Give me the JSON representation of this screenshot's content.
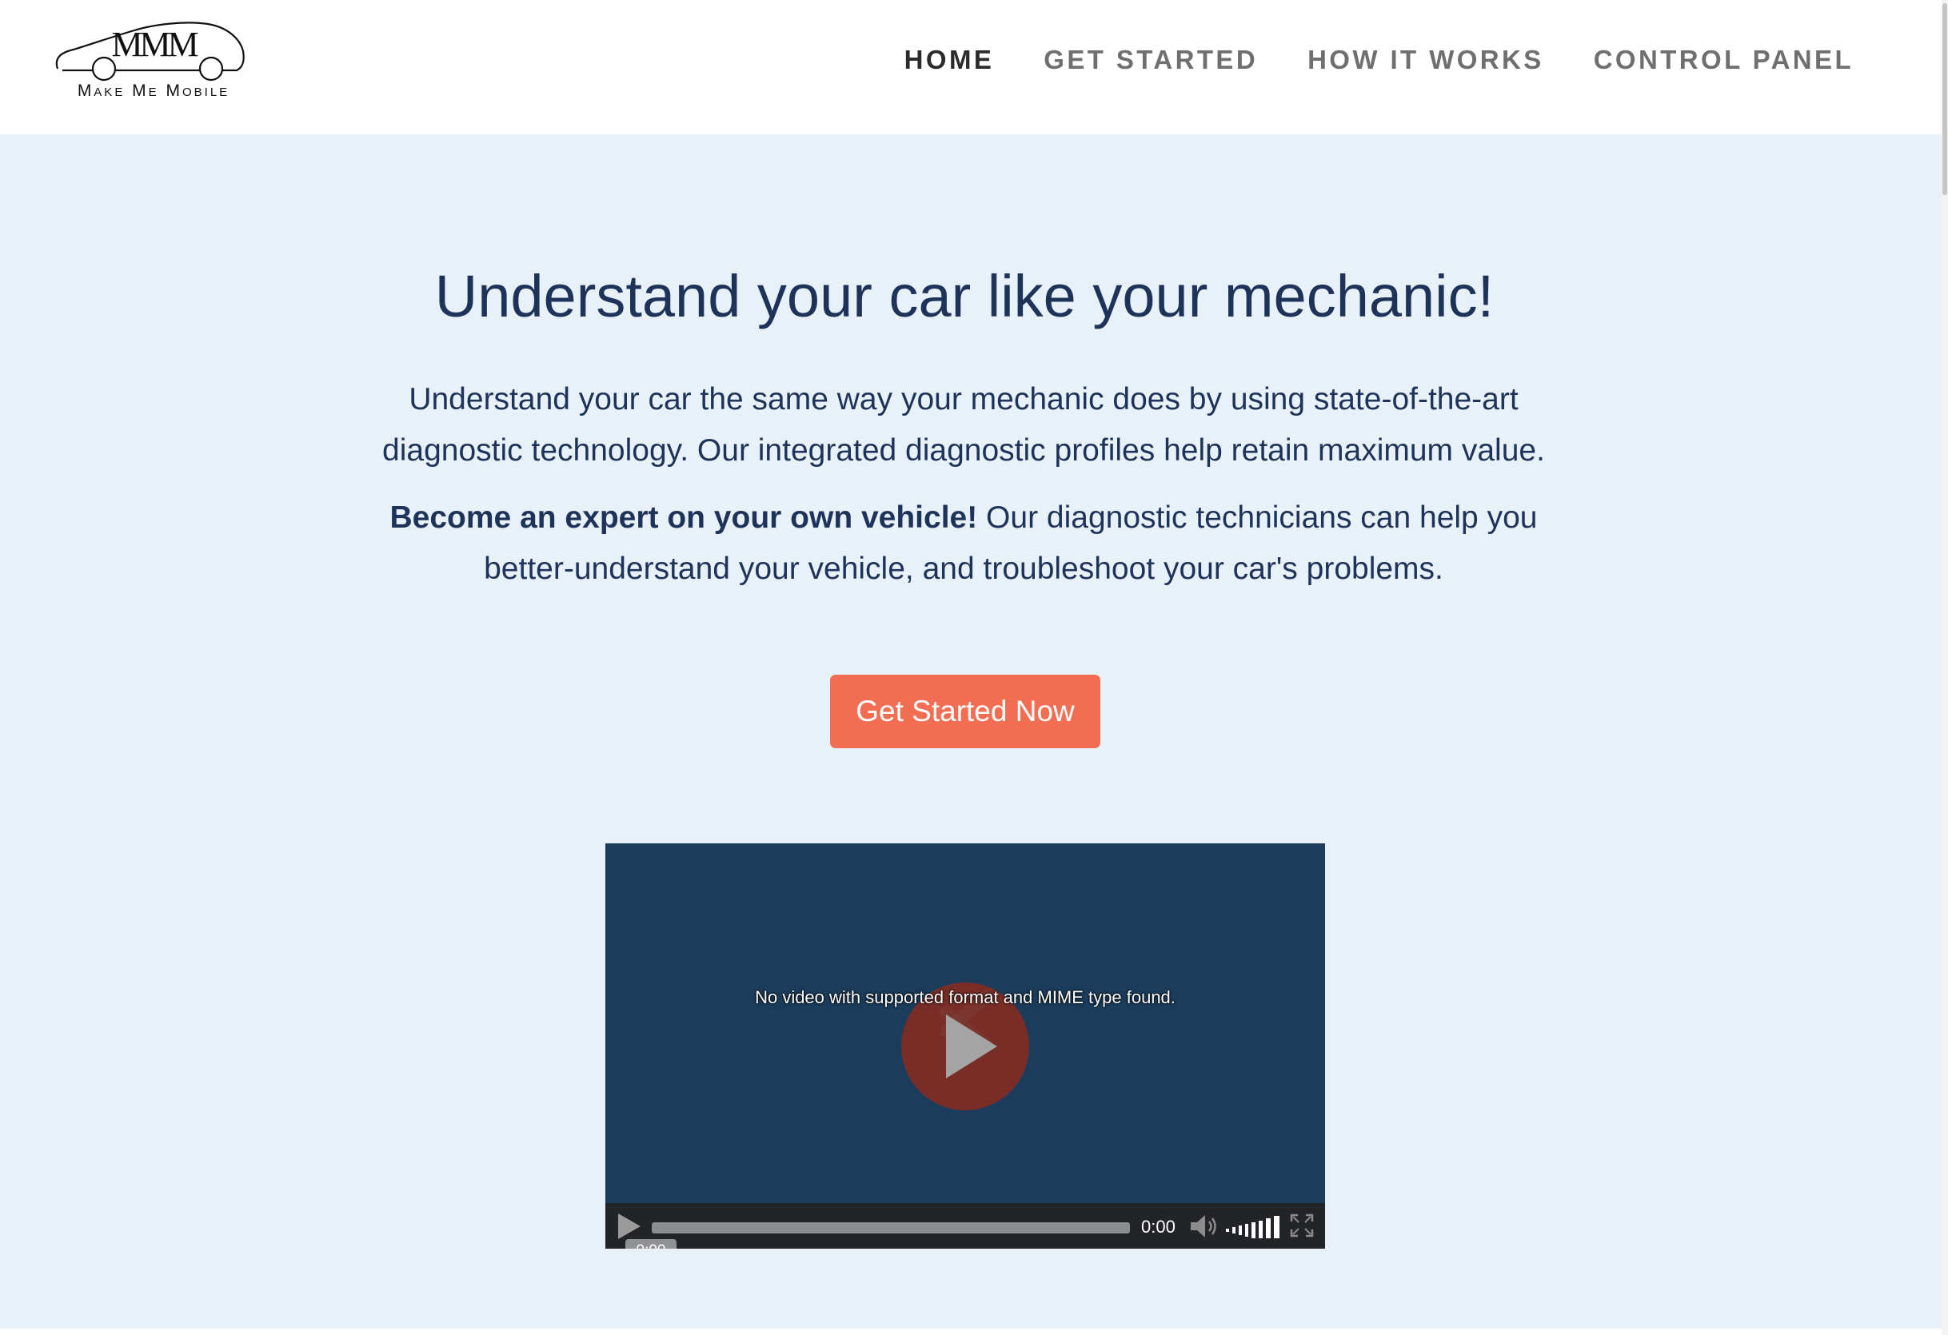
{
  "header": {
    "logo_monogram": "MMM",
    "logo_text": "Make Me Mobile",
    "nav": [
      {
        "label": "HOME",
        "active": true
      },
      {
        "label": "GET STARTED",
        "active": false
      },
      {
        "label": "HOW IT WORKS",
        "active": false
      },
      {
        "label": "CONTROL PANEL",
        "active": false
      }
    ]
  },
  "hero": {
    "title": "Understand your car like your mechanic!",
    "paragraph1": "Understand your car the same way your mechanic does by using state-of-the-art diagnostic technology. Our integrated diagnostic profiles help retain maximum value.",
    "paragraph2_bold": "Become an expert on your own vehicle!",
    "paragraph2_rest": " Our diagnostic technicians can help you better-understand your vehicle, and troubleshoot your car's problems.",
    "cta_label": "Get Started Now"
  },
  "video": {
    "error_message": "No video with supported format and MIME type found.",
    "time_tooltip": "0:00",
    "current_time": "0:00",
    "progress": 0
  },
  "colors": {
    "header_bg": "#ffffff",
    "hero_bg": "#e8f0f8",
    "heading_text": "#1d3359",
    "cta_bg": "#f16e53",
    "video_bg": "#1b3d5b",
    "controls_bg": "#222428",
    "play_overlay": "#8b2a1e"
  },
  "icons": {
    "big_play": "play-circle-icon",
    "error_overlay": "x-icon",
    "control_play": "play-icon",
    "mute": "speaker-icon",
    "volume": "volume-bars-icon",
    "fullscreen": "fullscreen-icon"
  }
}
